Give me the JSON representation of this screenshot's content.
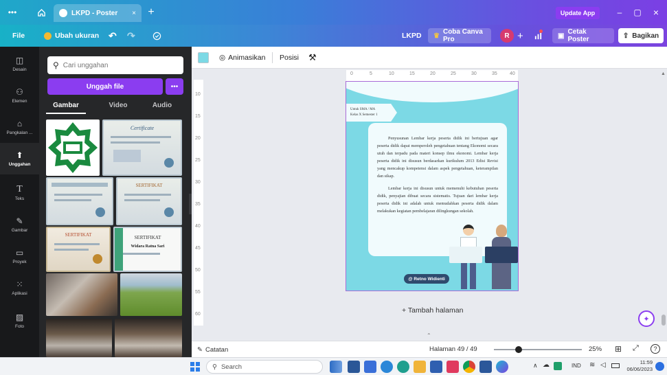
{
  "browser": {
    "tab_title": "LKPD - Poster",
    "update_app": "Update App"
  },
  "toolbar": {
    "file": "File",
    "resize": "Ubah ukuran",
    "doc_name": "LKPD",
    "try_pro": "Coba Canva Pro",
    "avatar_initial": "R",
    "print_poster": "Cetak Poster",
    "share": "Bagikan"
  },
  "rail": {
    "items": [
      {
        "label": "Desain",
        "icon": "design-icon"
      },
      {
        "label": "Elemen",
        "icon": "elements-icon"
      },
      {
        "label": "Pangkalan ...",
        "icon": "brand-icon"
      },
      {
        "label": "Unggahan",
        "icon": "upload-icon"
      },
      {
        "label": "Teks",
        "icon": "text-icon"
      },
      {
        "label": "Gambar",
        "icon": "draw-icon"
      },
      {
        "label": "Proyek",
        "icon": "folder-icon"
      },
      {
        "label": "Aplikasi",
        "icon": "apps-icon"
      },
      {
        "label": "Foto",
        "icon": "photo-icon"
      }
    ]
  },
  "panel": {
    "search_placeholder": "Cari unggahan",
    "upload_button": "Unggah file",
    "tabs": [
      "Gambar",
      "Video",
      "Audio"
    ],
    "cert_title_1": "Certificate",
    "cert_title_2": "SERTIFIKAT",
    "cert_title_3": "SERTIFIKAT",
    "cert_title_4": "SERTIFIKAT",
    "cert_name": "Widara Ratna Sari"
  },
  "workspace": {
    "animate": "Animasikan",
    "position": "Posisi",
    "ruler_top": [
      "0",
      "5",
      "10",
      "15",
      "20",
      "25",
      "30",
      "35",
      "40"
    ],
    "ruler_left": [
      "10",
      "15",
      "20",
      "25",
      "30",
      "35",
      "40",
      "45",
      "50",
      "55",
      "60"
    ],
    "page_label_line1": "Untuk SMA / MA",
    "page_label_line2": "Kelas X Semester 1",
    "paragraph1": "Penyusunan Lembar kerja peserta didik ini bertujuan agar peserta didik dapat memperoleh pengetahuan tentang Ekonomi secara utuh dan terpadu pada materi konsep ilmu ekonomi. Lembar kerja peserta didik ini disusun berdasarkan kurikulum 2013 Edisi Revisi yang mencakup kompetensi dalam aspek pengetahuan, keterampilan dan sikap.",
    "paragraph2": "Lembar kerja ini disusun untuk memenuhi kebutuhan peserta didik, penyajian dibuat secara sistematis. Tujuan dari lembar kerja peserta didik ini adalah untuk memudahkan peserta didik dalam melakukan kegiatan pembelajaran dilingkungan sekolah.",
    "author_tag": "@ Retno Widienti",
    "add_page": "+ Tambah halaman"
  },
  "bottombar": {
    "notes": "Catatan",
    "page_indicator": "Halaman 49 / 49",
    "zoom": "25%",
    "zoom_fraction": 0.28
  },
  "taskbar": {
    "search": "Search",
    "lang": "IND",
    "time": "11:59",
    "date": "06/06/2023"
  },
  "colors": {
    "accent_purple": "#8b3df0",
    "page_teal": "#7cd9e5"
  }
}
